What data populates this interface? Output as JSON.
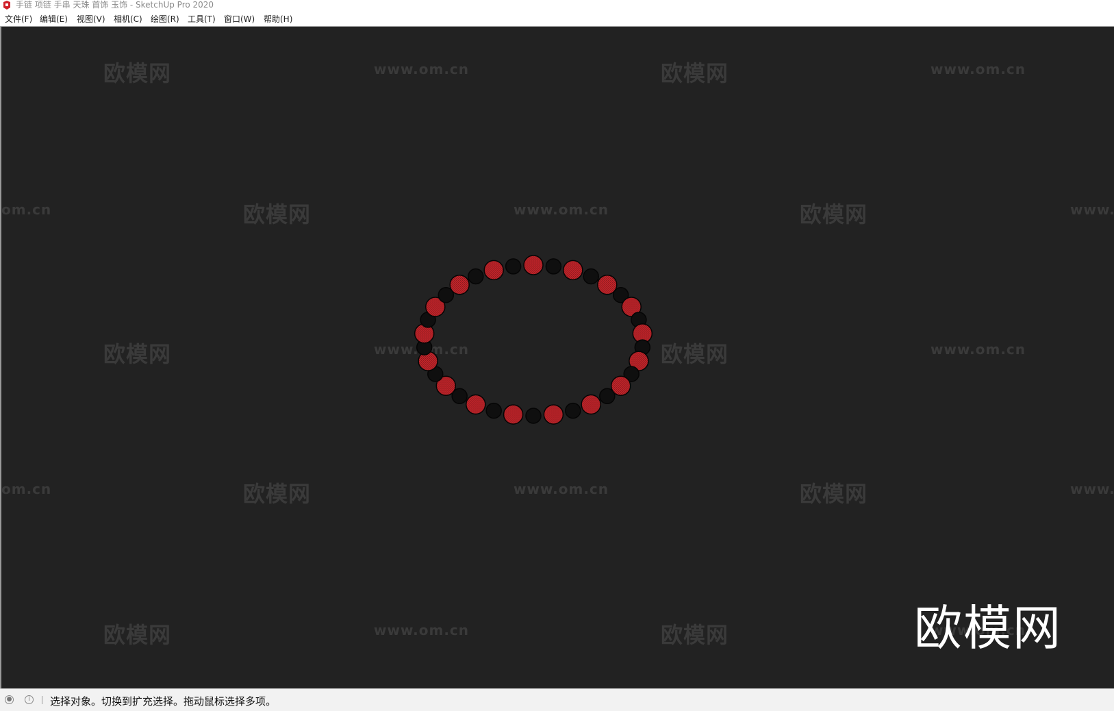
{
  "window": {
    "title": "手链 项链 手串 天珠 首饰 玉饰 - SketchUp Pro 2020",
    "app_icon": "sketchup-icon"
  },
  "menu": [
    {
      "label": "文件(F)"
    },
    {
      "label": "编辑(E)"
    },
    {
      "label": "视图(V)"
    },
    {
      "label": "相机(C)"
    },
    {
      "label": "绘图(R)"
    },
    {
      "label": "工具(T)"
    },
    {
      "label": "窗口(W)"
    },
    {
      "label": "帮助(H)"
    }
  ],
  "viewport": {
    "background": "#222222",
    "watermark_cn": "欧模网",
    "watermark_url": "www.om.cn",
    "watermark_url_partial_left": "om.cn",
    "watermark_url_partial_right": "www.",
    "logo_text": "欧模网",
    "model": {
      "description_colors": {
        "red_bead": "#c0242a",
        "black_bead": "#0f0f0f"
      }
    }
  },
  "status": {
    "icons": [
      "geo-location-icon",
      "info-icon"
    ],
    "text": "选择对象。切换到扩充选择。拖动鼠标选择多项。"
  }
}
